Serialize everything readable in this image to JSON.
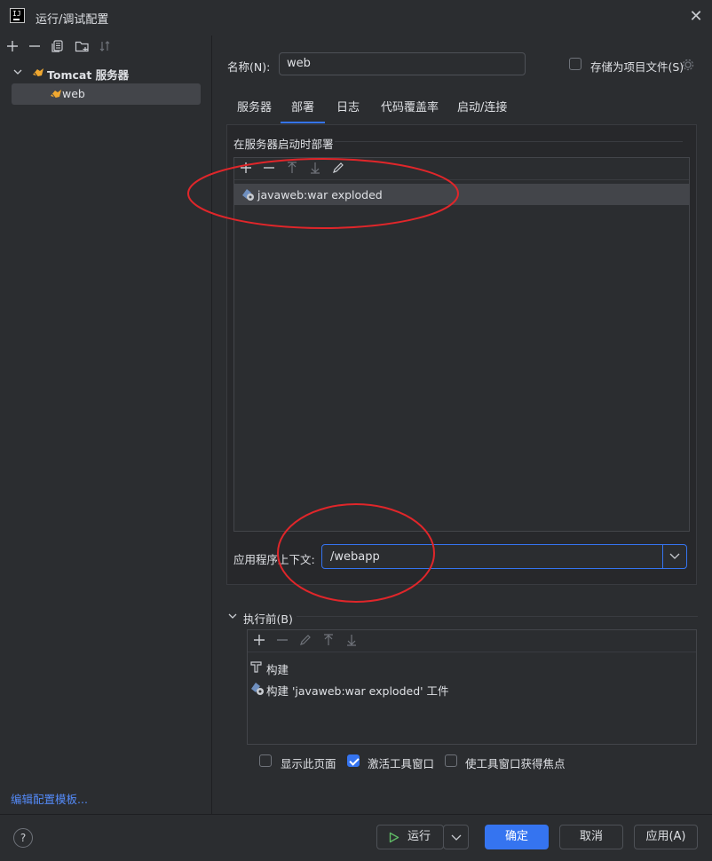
{
  "window": {
    "title": "运行/调试配置",
    "app_icon": "intellij-icon",
    "close": "✕"
  },
  "left": {
    "toolbar": [
      "add-icon",
      "remove-icon",
      "copy-icon",
      "folder-add-icon",
      "sort-icon"
    ],
    "tree": {
      "group_label": "Tomcat 服务器",
      "item_label": "web"
    },
    "edit_templates": "编辑配置模板..."
  },
  "form": {
    "name_label": "名称(N):",
    "name_value": "web",
    "store_as_file_label": "存储为项目文件(S)",
    "store_as_file_checked": false
  },
  "tabs": [
    {
      "label": "服务器",
      "active": false
    },
    {
      "label": "部署",
      "active": true
    },
    {
      "label": "日志",
      "active": false
    },
    {
      "label": "代码覆盖率",
      "active": false
    },
    {
      "label": "启动/连接",
      "active": false
    }
  ],
  "deploy": {
    "section_title": "在服务器启动时部署",
    "artifacts": [
      "javaweb:war exploded"
    ],
    "context_label": "应用程序上下文:",
    "context_value": "/webapp"
  },
  "before_launch": {
    "title": "执行前(B)",
    "tasks": [
      "构建",
      "构建 'javaweb:war exploded' 工件"
    ],
    "show_page_label": "显示此页面",
    "show_page_checked": false,
    "activate_window_label": "激活工具窗口",
    "activate_window_checked": true,
    "focus_window_label": "使工具窗口获得焦点",
    "focus_window_checked": false
  },
  "buttons": {
    "help": "?",
    "run": "运行",
    "ok": "确定",
    "cancel": "取消",
    "apply": "应用(A)"
  },
  "colors": {
    "accent": "#3574f0",
    "annotation": "#e0262a",
    "link": "#548af7",
    "tomcat_icon": "#f0a830"
  }
}
